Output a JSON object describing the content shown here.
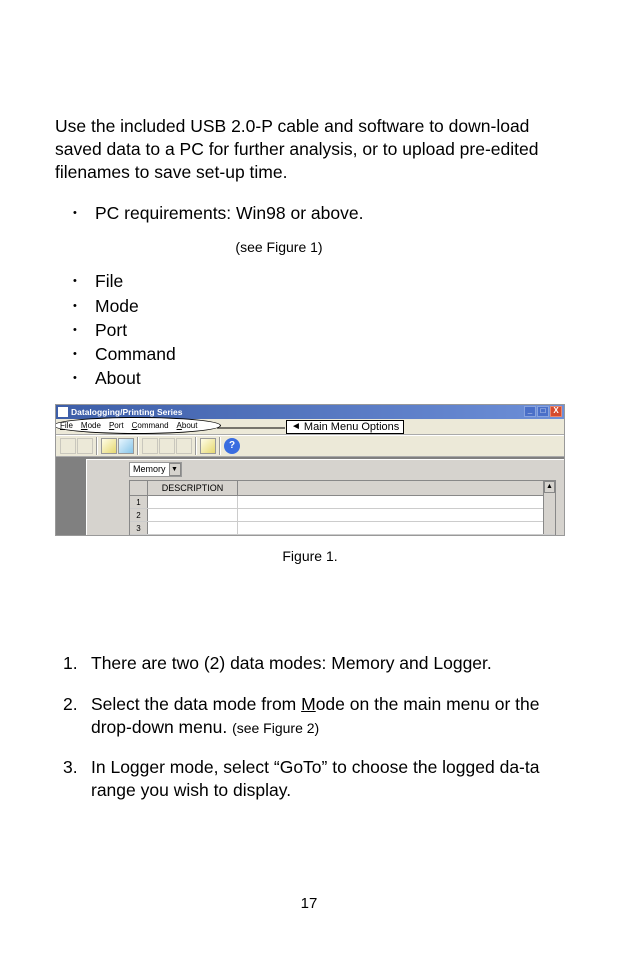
{
  "intro": "Use the included USB 2.0-P cable and software to down-load saved data to a PC for further analysis, or to    upload pre-edited filenames to save set-up time.",
  "pc_req": "PC requirements: Win98 or above.",
  "see_fig1": "(see Figure 1)",
  "menu_list": {
    "file": "File",
    "mode": "Mode",
    "port": "Port",
    "command": "Command",
    "about": "About"
  },
  "screenshot": {
    "title": "Datalogging/Printing Series",
    "callout": "Main Menu Options",
    "menubar": {
      "file_pre": "F",
      "file_rest": "ile",
      "mode_pre": "M",
      "mode_rest": "ode",
      "port_pre": "P",
      "port_rest": "ort",
      "command_pre": "C",
      "command_rest": "ommand",
      "about_pre": "A",
      "about_rest": "bout"
    },
    "dropdown": "Memory",
    "grid_header": "DESCRIPTION",
    "rows": {
      "r1": "1",
      "r2": "2",
      "r3": "3"
    },
    "winbtns": {
      "min": "_",
      "max": "□",
      "close": "X"
    }
  },
  "figure_caption": "Figure 1.",
  "steps": {
    "s1": "There are two (2) data modes: Memory and Logger.",
    "s2a": "Select the data mode from ",
    "s2_mode_letter": "M",
    "s2b": "ode on the main menu or the drop-down menu. ",
    "s2_ref": "(see Figure 2)",
    "s3": "In Logger mode, select “GoTo” to choose the logged da-ta range you wish to display."
  },
  "page_number": "17"
}
